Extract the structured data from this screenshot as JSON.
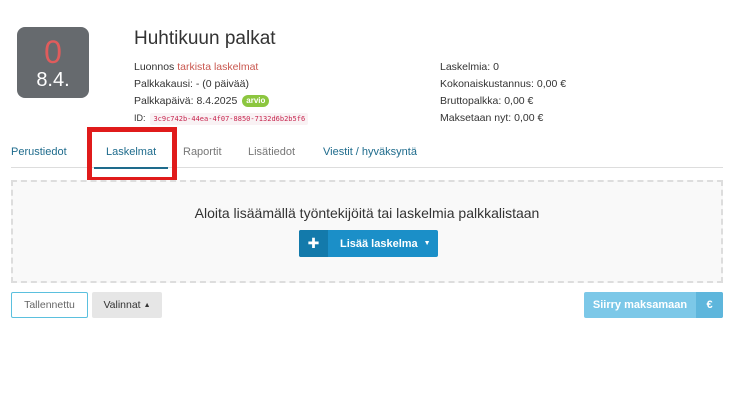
{
  "header": {
    "count": "0",
    "date": "8.4.",
    "title": "Huhtikuun palkat",
    "status_prefix": "Luonnos",
    "status_link": "tarkista laskelmat",
    "period": "Palkkakausi: - (0 päivää)",
    "payday": "Palkkapäivä: 8.4.2025",
    "payday_badge": "arvio",
    "id_label": "ID:",
    "id_value": "3c9c742b-44ea-4f07-8850-7132d6b2b5f6",
    "laskelmia": "Laskelmia: 0",
    "kokonaiskustannus": "Kokonaiskustannus: 0,00 €",
    "bruttopalkka": "Bruttopalkka: 0,00 €",
    "maksetaan": "Maksetaan nyt: 0,00 €"
  },
  "tabs": [
    {
      "label": "Perustiedot"
    },
    {
      "label": "Laskelmat",
      "active": true
    },
    {
      "label": "Raportit"
    },
    {
      "label": "Lisätiedot"
    },
    {
      "label": "Viestit / hyväksyntä"
    }
  ],
  "main": {
    "empty_message": "Aloita lisäämällä työntekijöitä tai laskelmia palkkalistaan",
    "add_button": "Lisää laskelma",
    "add_icon": "plus-icon"
  },
  "footer": {
    "saved": "Tallennettu",
    "options": "Valinnat",
    "pay": "Siirry maksamaan",
    "pay_icon": "€"
  },
  "colors": {
    "primary": "#1b8fc8",
    "highlight": "#e01b1b",
    "badge": "#8cc63f",
    "pay": "#7cc8e8"
  }
}
